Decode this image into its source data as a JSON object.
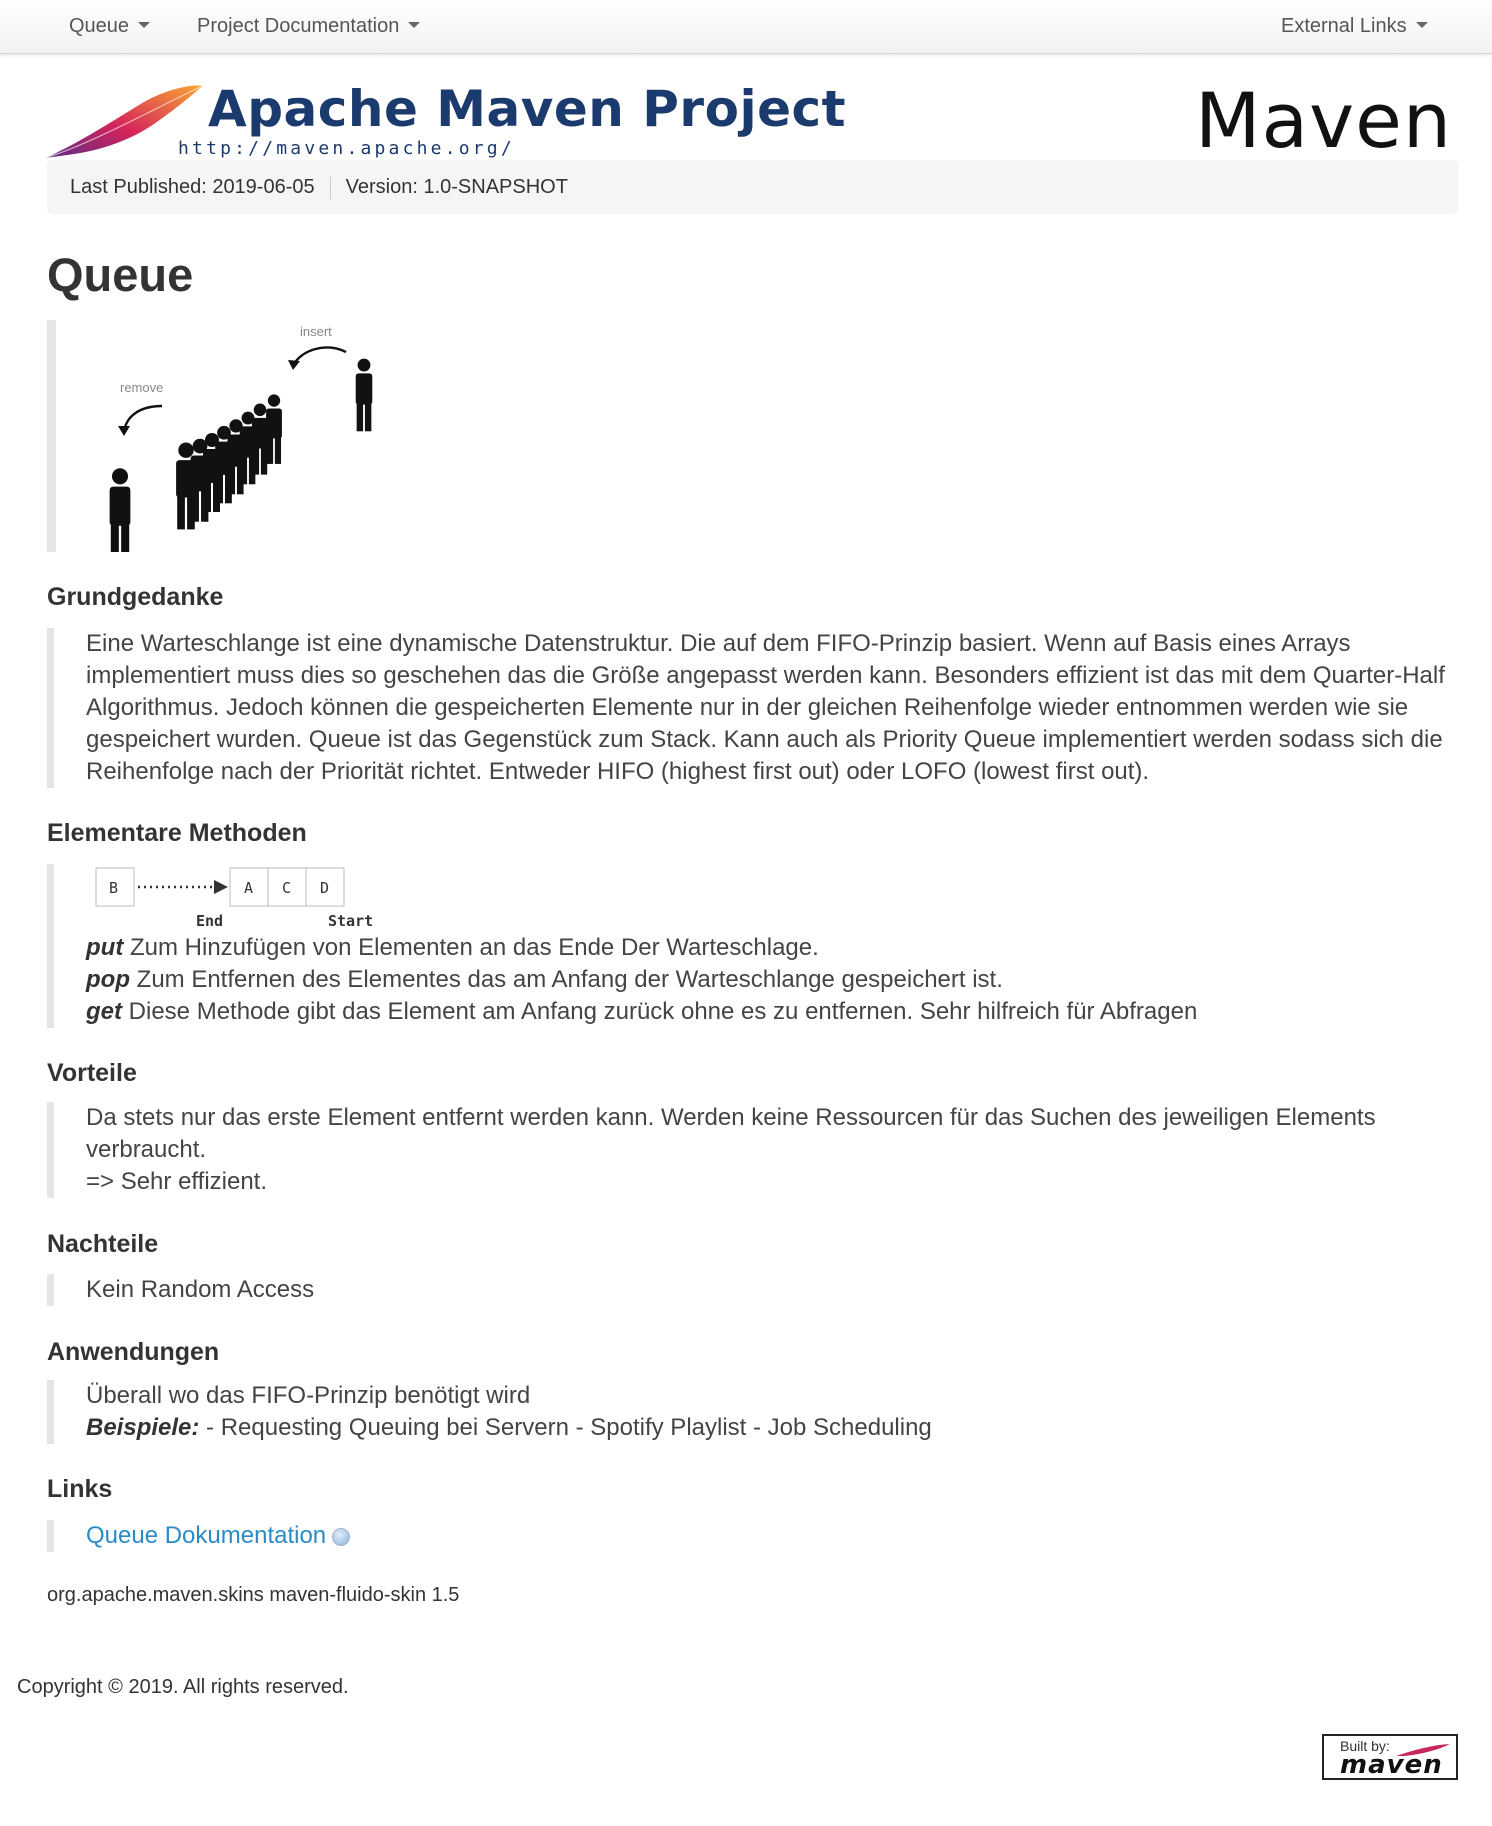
{
  "nav": {
    "queue": "Queue",
    "docs": "Project Documentation",
    "external": "External Links"
  },
  "banner": {
    "title": "Apache Maven Project",
    "url": "http://maven.apache.org/",
    "right_logo": "Maven"
  },
  "breadcrumb": {
    "published": "Last Published: 2019-06-05",
    "version": "Version: 1.0-SNAPSHOT"
  },
  "page_title": "Queue",
  "figure": {
    "insert_label": "insert",
    "remove_label": "remove"
  },
  "sections": {
    "grundgedanke": {
      "heading": "Grundgedanke",
      "text": "Eine Warteschlange ist eine dynamische Datenstruktur. Die auf dem FIFO-Prinzip basiert. Wenn auf Basis eines Arrays implementiert muss dies so geschehen das die Größe angepasst werden kann. Besonders effizient ist das mit dem Quarter-Half Algorithmus. Jedoch können die gespeicherten Elemente nur in der gleichen Reihenfolge wieder entnommen werden wie sie gespeichert wurden. Queue ist das Gegenstück zum Stack. Kann auch als Priority Queue implementiert werden sodass sich die Reihenfolge nach der Priorität richtet. Entweder HIFO (highest first out) oder LOFO (lowest first out)."
    },
    "methoden": {
      "heading": "Elementare Methoden",
      "diagram": {
        "cells": [
          "B",
          "A",
          "C",
          "D"
        ],
        "end_label": "End",
        "start_label": "Start"
      },
      "items": [
        {
          "name": "put",
          "text": " Zum Hinzufügen von Elementen an das Ende Der Warteschlage."
        },
        {
          "name": "pop",
          "text": " Zum Entfernen des Elementes das am Anfang der Warteschlange gespeichert ist."
        },
        {
          "name": "get",
          "text": " Diese Methode gibt das Element am Anfang zurück ohne es zu entfernen. Sehr hilfreich für Abfragen"
        }
      ]
    },
    "vorteile": {
      "heading": "Vorteile",
      "line1": "Da stets nur das erste Element entfernt werden kann. Werden keine Ressourcen für das Suchen des jeweiligen Elements verbraucht.",
      "line2": "=> Sehr effizient."
    },
    "nachteile": {
      "heading": "Nachteile",
      "text": "Kein Random Access"
    },
    "anwendungen": {
      "heading": "Anwendungen",
      "line1": "Überall wo das FIFO-Prinzip benötigt wird",
      "examples_label": "Beispiele:",
      "examples_text": " - Requesting Queuing bei Servern - Spotify Playlist - Job Scheduling"
    },
    "links": {
      "heading": "Links",
      "link_text": "Queue Dokumentation"
    }
  },
  "footer": {
    "skin": "org.apache.maven.skins maven-fluido-skin 1.5",
    "copyright": "Copyright © 2019. All rights reserved.",
    "built_by_label": "Built by:",
    "built_by_logo": "maven"
  },
  "colors": {
    "brand_blue": "#1b3a6e",
    "link": "#2a8bc7",
    "quote_border": "#e5e5e5"
  }
}
